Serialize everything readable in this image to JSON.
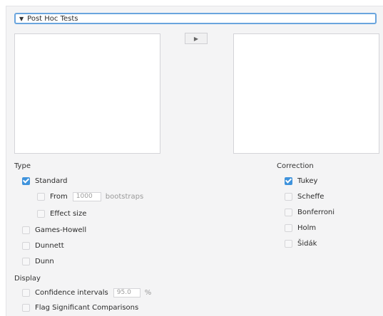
{
  "section": {
    "title": "Post Hoc Tests"
  },
  "transfer": {
    "arrow_glyph": "▶"
  },
  "type": {
    "label": "Type",
    "standard": {
      "label": "Standard",
      "checked": true
    },
    "from": {
      "label": "From",
      "value": "1000",
      "suffix": "bootstraps",
      "checked": false
    },
    "effect_size": {
      "label": "Effect size",
      "checked": false
    },
    "games_howell": {
      "label": "Games-Howell",
      "checked": false
    },
    "dunnett": {
      "label": "Dunnett",
      "checked": false
    },
    "dunn": {
      "label": "Dunn",
      "checked": false
    }
  },
  "correction": {
    "label": "Correction",
    "tukey": {
      "label": "Tukey",
      "checked": true
    },
    "scheffe": {
      "label": "Scheffe",
      "checked": false
    },
    "bonferroni": {
      "label": "Bonferroni",
      "checked": false
    },
    "holm": {
      "label": "Holm",
      "checked": false
    },
    "sidak": {
      "label": "Šidák",
      "checked": false
    }
  },
  "display": {
    "label": "Display",
    "ci": {
      "label": "Confidence intervals",
      "value": "95.0",
      "suffix": "%",
      "checked": false
    },
    "flag": {
      "label": "Flag Significant Comparisons",
      "checked": false
    }
  },
  "colors": {
    "accent": "#3f93dc",
    "header_border": "#6aa5de"
  }
}
